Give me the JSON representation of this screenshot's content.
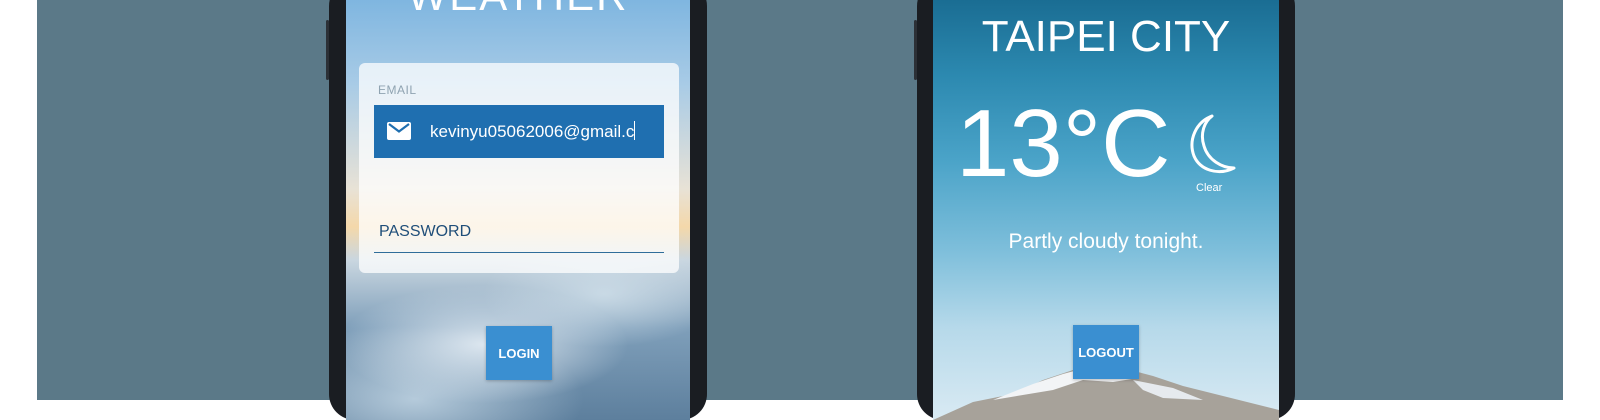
{
  "colors": {
    "background_panel": "#5b7988",
    "email_field_bg": "#1f6fb0",
    "button_bg": "#3a8fd1",
    "text_on_dark": "#ffffff"
  },
  "login_screen": {
    "app_title": "WEATHER",
    "email_label": "EMAIL",
    "email_value": "kevinyu05062006@gmail.c",
    "email_icon": "mail-icon",
    "password_placeholder": "PASSWORD",
    "login_label": "LOGIN"
  },
  "weather_screen": {
    "city": "TAIPEI CITY",
    "temperature": "13°C",
    "condition_icon": "moon-icon",
    "condition": "Clear",
    "summary": "Partly cloudy tonight.",
    "logout_label": "LOGOUT"
  }
}
